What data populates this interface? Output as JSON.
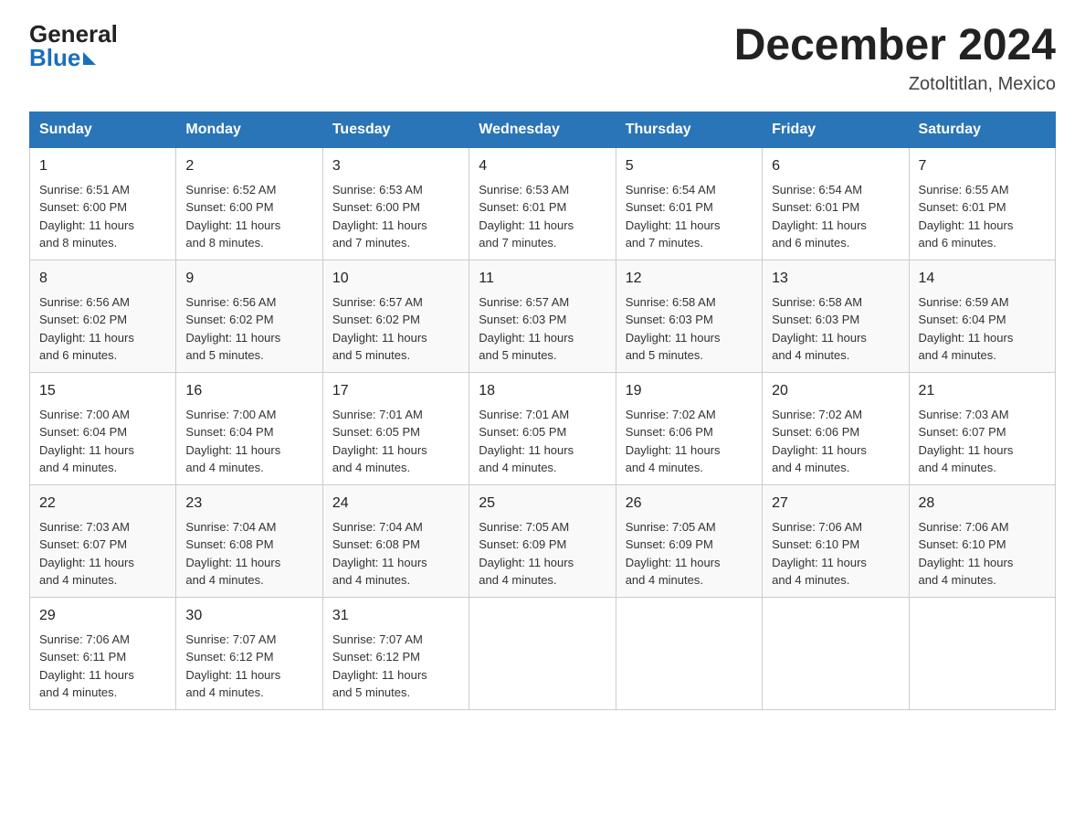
{
  "header": {
    "logo_line1": "General",
    "logo_line2": "Blue",
    "month_title": "December 2024",
    "location": "Zotoltitlan, Mexico"
  },
  "calendar": {
    "days_of_week": [
      "Sunday",
      "Monday",
      "Tuesday",
      "Wednesday",
      "Thursday",
      "Friday",
      "Saturday"
    ],
    "weeks": [
      [
        {
          "day": "1",
          "sunrise": "6:51 AM",
          "sunset": "6:00 PM",
          "daylight": "11 hours and 8 minutes."
        },
        {
          "day": "2",
          "sunrise": "6:52 AM",
          "sunset": "6:00 PM",
          "daylight": "11 hours and 8 minutes."
        },
        {
          "day": "3",
          "sunrise": "6:53 AM",
          "sunset": "6:00 PM",
          "daylight": "11 hours and 7 minutes."
        },
        {
          "day": "4",
          "sunrise": "6:53 AM",
          "sunset": "6:01 PM",
          "daylight": "11 hours and 7 minutes."
        },
        {
          "day": "5",
          "sunrise": "6:54 AM",
          "sunset": "6:01 PM",
          "daylight": "11 hours and 7 minutes."
        },
        {
          "day": "6",
          "sunrise": "6:54 AM",
          "sunset": "6:01 PM",
          "daylight": "11 hours and 6 minutes."
        },
        {
          "day": "7",
          "sunrise": "6:55 AM",
          "sunset": "6:01 PM",
          "daylight": "11 hours and 6 minutes."
        }
      ],
      [
        {
          "day": "8",
          "sunrise": "6:56 AM",
          "sunset": "6:02 PM",
          "daylight": "11 hours and 6 minutes."
        },
        {
          "day": "9",
          "sunrise": "6:56 AM",
          "sunset": "6:02 PM",
          "daylight": "11 hours and 5 minutes."
        },
        {
          "day": "10",
          "sunrise": "6:57 AM",
          "sunset": "6:02 PM",
          "daylight": "11 hours and 5 minutes."
        },
        {
          "day": "11",
          "sunrise": "6:57 AM",
          "sunset": "6:03 PM",
          "daylight": "11 hours and 5 minutes."
        },
        {
          "day": "12",
          "sunrise": "6:58 AM",
          "sunset": "6:03 PM",
          "daylight": "11 hours and 5 minutes."
        },
        {
          "day": "13",
          "sunrise": "6:58 AM",
          "sunset": "6:03 PM",
          "daylight": "11 hours and 4 minutes."
        },
        {
          "day": "14",
          "sunrise": "6:59 AM",
          "sunset": "6:04 PM",
          "daylight": "11 hours and 4 minutes."
        }
      ],
      [
        {
          "day": "15",
          "sunrise": "7:00 AM",
          "sunset": "6:04 PM",
          "daylight": "11 hours and 4 minutes."
        },
        {
          "day": "16",
          "sunrise": "7:00 AM",
          "sunset": "6:04 PM",
          "daylight": "11 hours and 4 minutes."
        },
        {
          "day": "17",
          "sunrise": "7:01 AM",
          "sunset": "6:05 PM",
          "daylight": "11 hours and 4 minutes."
        },
        {
          "day": "18",
          "sunrise": "7:01 AM",
          "sunset": "6:05 PM",
          "daylight": "11 hours and 4 minutes."
        },
        {
          "day": "19",
          "sunrise": "7:02 AM",
          "sunset": "6:06 PM",
          "daylight": "11 hours and 4 minutes."
        },
        {
          "day": "20",
          "sunrise": "7:02 AM",
          "sunset": "6:06 PM",
          "daylight": "11 hours and 4 minutes."
        },
        {
          "day": "21",
          "sunrise": "7:03 AM",
          "sunset": "6:07 PM",
          "daylight": "11 hours and 4 minutes."
        }
      ],
      [
        {
          "day": "22",
          "sunrise": "7:03 AM",
          "sunset": "6:07 PM",
          "daylight": "11 hours and 4 minutes."
        },
        {
          "day": "23",
          "sunrise": "7:04 AM",
          "sunset": "6:08 PM",
          "daylight": "11 hours and 4 minutes."
        },
        {
          "day": "24",
          "sunrise": "7:04 AM",
          "sunset": "6:08 PM",
          "daylight": "11 hours and 4 minutes."
        },
        {
          "day": "25",
          "sunrise": "7:05 AM",
          "sunset": "6:09 PM",
          "daylight": "11 hours and 4 minutes."
        },
        {
          "day": "26",
          "sunrise": "7:05 AM",
          "sunset": "6:09 PM",
          "daylight": "11 hours and 4 minutes."
        },
        {
          "day": "27",
          "sunrise": "7:06 AM",
          "sunset": "6:10 PM",
          "daylight": "11 hours and 4 minutes."
        },
        {
          "day": "28",
          "sunrise": "7:06 AM",
          "sunset": "6:10 PM",
          "daylight": "11 hours and 4 minutes."
        }
      ],
      [
        {
          "day": "29",
          "sunrise": "7:06 AM",
          "sunset": "6:11 PM",
          "daylight": "11 hours and 4 minutes."
        },
        {
          "day": "30",
          "sunrise": "7:07 AM",
          "sunset": "6:12 PM",
          "daylight": "11 hours and 4 minutes."
        },
        {
          "day": "31",
          "sunrise": "7:07 AM",
          "sunset": "6:12 PM",
          "daylight": "11 hours and 5 minutes."
        },
        null,
        null,
        null,
        null
      ]
    ],
    "sunrise_label": "Sunrise:",
    "sunset_label": "Sunset:",
    "daylight_label": "Daylight:"
  }
}
